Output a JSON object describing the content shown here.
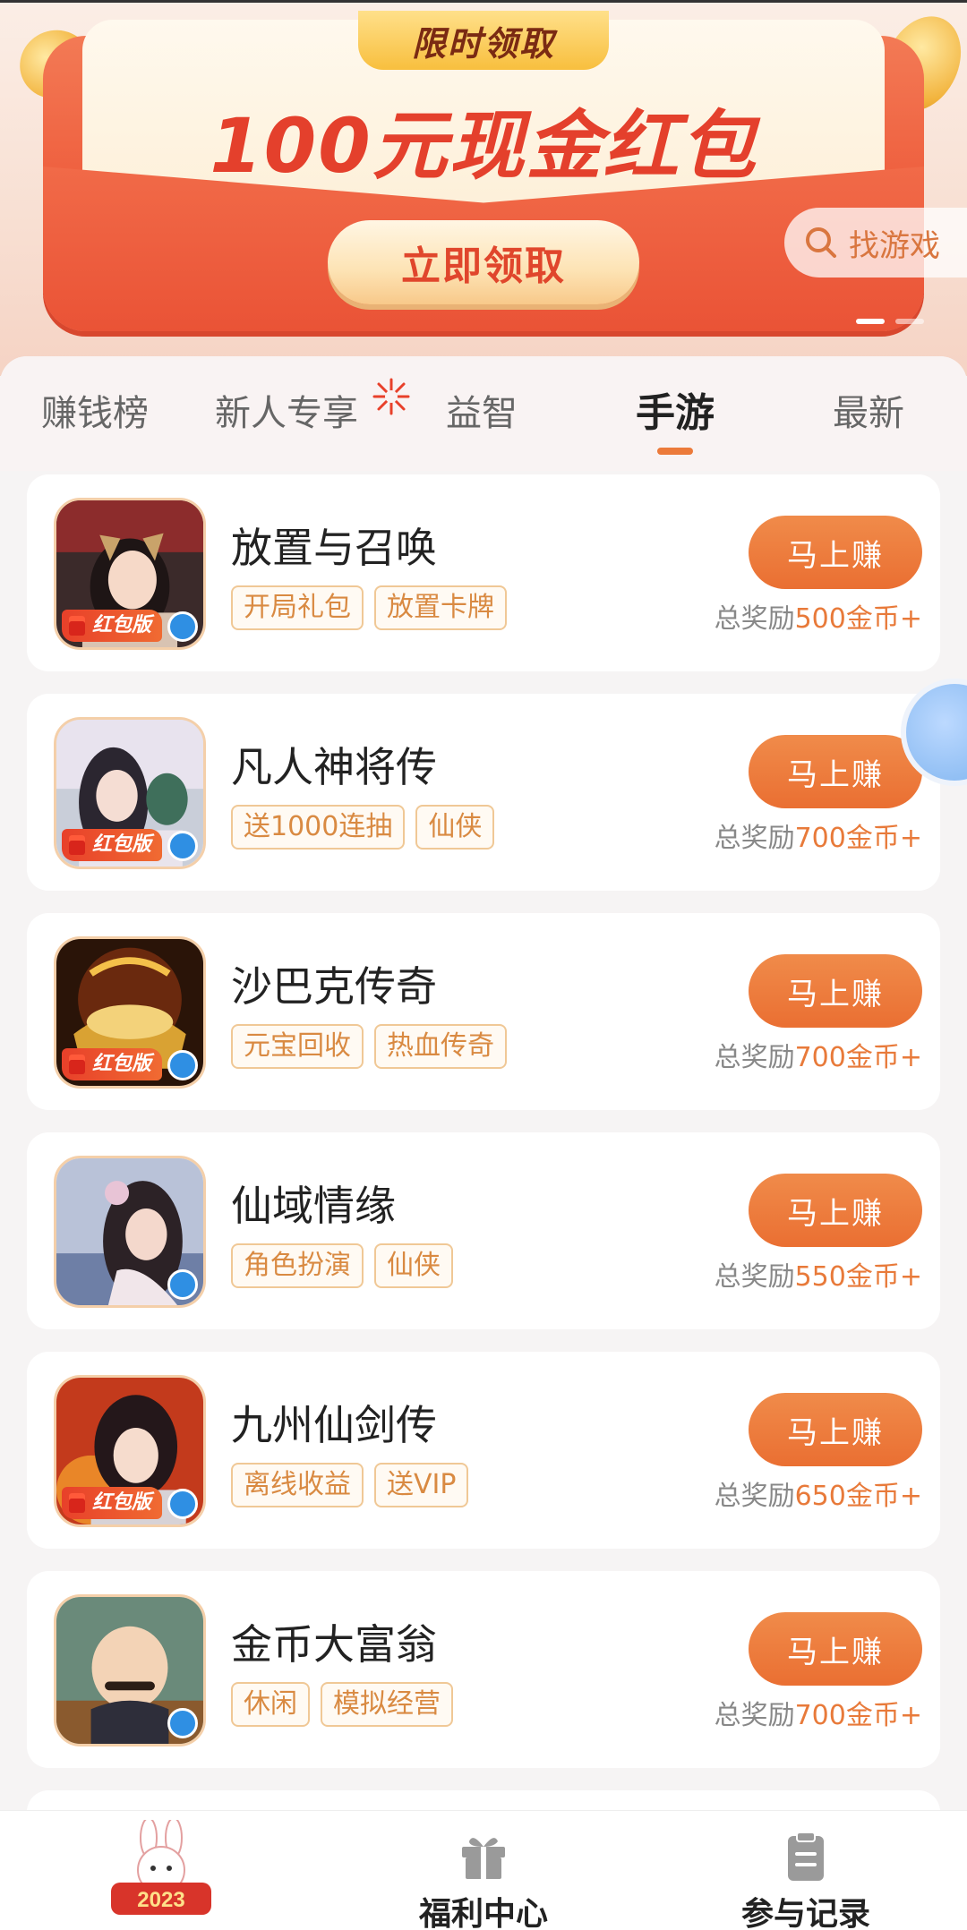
{
  "banner": {
    "ribbon_label": "限时领取",
    "headline": "100元现金红包",
    "claim_button": "立即领取",
    "search_button": "找游戏",
    "slide_count": 2,
    "active_slide": 1
  },
  "tabs": [
    {
      "label": "赚钱榜",
      "active": false
    },
    {
      "label": "新人专享",
      "active": false
    },
    {
      "label": "益智",
      "active": false
    },
    {
      "label": "手游",
      "active": true
    },
    {
      "label": "最新",
      "active": false
    }
  ],
  "games": [
    {
      "name": "放置与召唤",
      "tags": [
        "开局礼包",
        "放置卡牌"
      ],
      "button": "马上赚",
      "reward_prefix": "总奖励",
      "reward_amount": "500金币+",
      "badge": "红包版",
      "icon": "fantasy-girl-icon"
    },
    {
      "name": "凡人神将传",
      "tags": [
        "送1000连抽",
        "仙侠"
      ],
      "button": "马上赚",
      "reward_prefix": "总奖励",
      "reward_amount": "700金币+",
      "badge": "红包版",
      "icon": "xianxia-heroine-icon"
    },
    {
      "name": "沙巴克传奇",
      "tags": [
        "元宝回收",
        "热血传奇"
      ],
      "button": "马上赚",
      "reward_prefix": "总奖励",
      "reward_amount": "700金币+",
      "badge": "红包版",
      "icon": "gold-ingot-dragon-icon"
    },
    {
      "name": "仙域情缘",
      "tags": [
        "角色扮演",
        "仙侠"
      ],
      "button": "马上赚",
      "reward_prefix": "总奖励",
      "reward_amount": "550金币+",
      "badge": "",
      "icon": "fairy-lady-icon"
    },
    {
      "name": "九州仙剑传",
      "tags": [
        "离线收益",
        "送VIP"
      ],
      "button": "马上赚",
      "reward_prefix": "总奖励",
      "reward_amount": "650金币+",
      "badge": "红包版",
      "icon": "swordsman-icon"
    },
    {
      "name": "金币大富翁",
      "tags": [
        "休闲",
        "模拟经营"
      ],
      "button": "马上赚",
      "reward_prefix": "总奖励",
      "reward_amount": "700金币+",
      "badge": "",
      "icon": "tycoon-man-icon"
    }
  ],
  "bottom_nav": {
    "home_icon": "rabbit-2023-icon",
    "home_icon_text": "2023",
    "welfare_label": "福利中心",
    "records_label": "参与记录"
  },
  "colors": {
    "accent": "#ec7a3a",
    "banner_red": "#ee5c3c",
    "tag_text": "#d98a42",
    "tag_border": "#f0c896"
  }
}
